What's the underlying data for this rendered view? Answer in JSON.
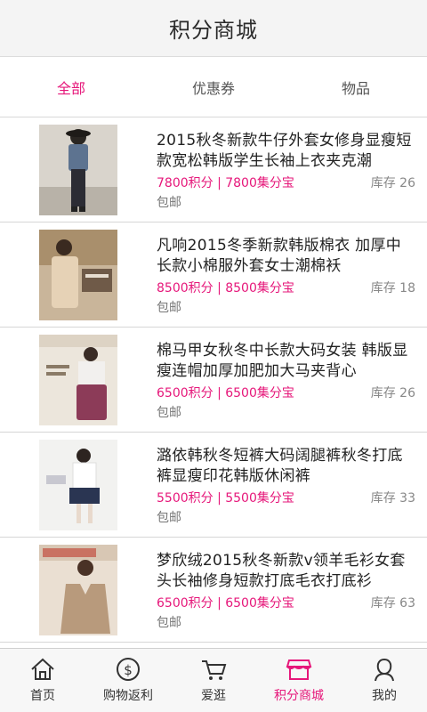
{
  "header": {
    "title": "积分商城"
  },
  "tabs": [
    {
      "label": "全部",
      "active": true
    },
    {
      "label": "优惠券",
      "active": false
    },
    {
      "label": "物品",
      "active": false
    }
  ],
  "items": [
    {
      "title": "2015秋冬新款牛仔外套女修身显瘦短款宽松韩版学生长袖上衣夹克潮",
      "price": "7800积分 | 7800集分宝",
      "stock": "库存 26",
      "shipping": "包邮"
    },
    {
      "title": "凡响2015冬季新款韩版棉衣 加厚中长款小棉服外套女士潮棉袄",
      "price": "8500积分 | 8500集分宝",
      "stock": "库存 18",
      "shipping": "包邮"
    },
    {
      "title": "棉马甲女秋冬中长款大码女装 韩版显瘦连帽加厚加肥加大马夹背心",
      "price": "6500积分 | 6500集分宝",
      "stock": "库存 26",
      "shipping": "包邮"
    },
    {
      "title": "潞依韩秋冬短裤大码阔腿裤秋冬打底裤显瘦印花韩版休闲裤",
      "price": "5500积分 | 5500集分宝",
      "stock": "库存 33",
      "shipping": "包邮"
    },
    {
      "title": "梦欣绒2015秋冬新款v领羊毛衫女套头长袖修身短款打底毛衣打底衫",
      "price": "6500积分 | 6500集分宝",
      "stock": "库存 63",
      "shipping": "包邮"
    }
  ],
  "nav": [
    {
      "label": "首页",
      "icon": "home-icon",
      "active": false
    },
    {
      "label": "购物返利",
      "icon": "coin-icon",
      "active": false
    },
    {
      "label": "爱逛",
      "icon": "cart-icon",
      "active": false
    },
    {
      "label": "积分商城",
      "icon": "store-icon",
      "active": true
    },
    {
      "label": "我的",
      "icon": "profile-icon",
      "active": false
    }
  ],
  "colors": {
    "accent": "#e6177a",
    "text": "#222222",
    "muted": "#888888"
  }
}
